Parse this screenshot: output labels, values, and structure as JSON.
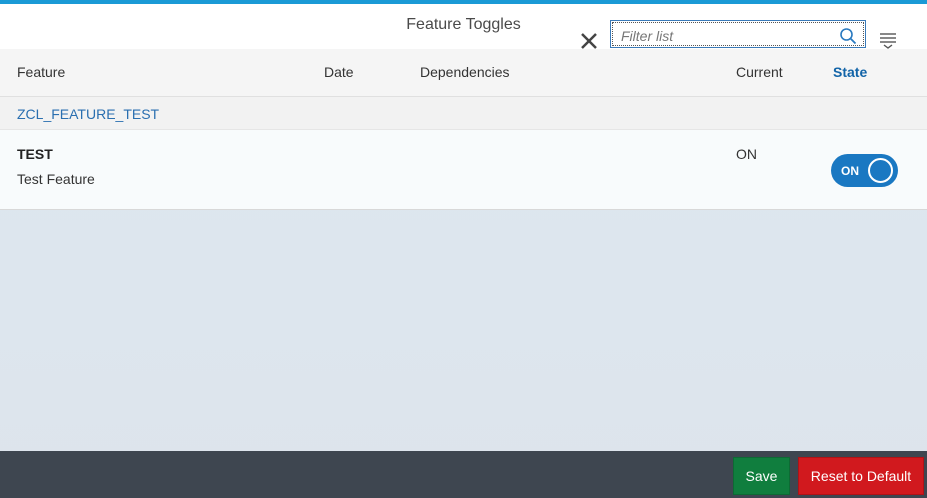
{
  "header": {
    "title": "Feature Toggles",
    "search_placeholder": "Filter list"
  },
  "columns": {
    "feature": "Feature",
    "date": "Date",
    "dependencies": "Dependencies",
    "current": "Current",
    "state": "State"
  },
  "groups": [
    {
      "title": "ZCL_FEATURE_TEST",
      "rows": [
        {
          "name": "TEST",
          "description": "Test Feature",
          "date": "",
          "dependencies": "",
          "current": "ON",
          "state_label": "ON",
          "state_on": true
        }
      ]
    }
  ],
  "footer": {
    "save_label": "Save",
    "reset_label": "Reset to Default"
  },
  "colors": {
    "accent": "#1a9ad6",
    "toggle_on": "#1a78c2",
    "save": "#107e3e",
    "reset": "#d1191e",
    "footer_bg": "#3e4650"
  },
  "icons": {
    "close": "close-icon",
    "search": "search-icon",
    "menu": "sort-menu-icon"
  }
}
